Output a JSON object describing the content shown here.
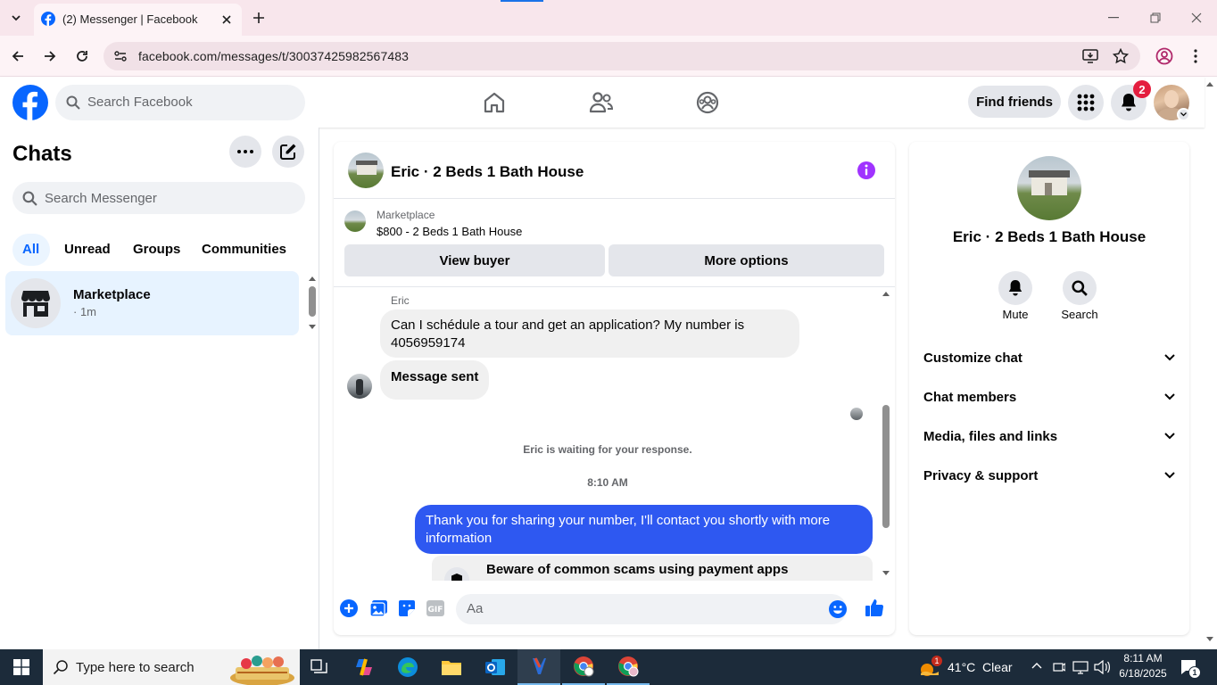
{
  "browser": {
    "tab_title": "(2) Messenger | Facebook",
    "url": "facebook.com/messages/t/30037425982567483"
  },
  "fb": {
    "search_placeholder": "Search Facebook",
    "find_friends": "Find friends",
    "notif_count": "2"
  },
  "left": {
    "title": "Chats",
    "search_placeholder": "Search Messenger",
    "filters": [
      "All",
      "Unread",
      "Groups",
      "Communities"
    ],
    "conversations": [
      {
        "name": "Marketplace",
        "meta": "· 1m"
      }
    ]
  },
  "chat": {
    "title": "Eric · 2 Beds 1 Bath House",
    "listing_label": "Marketplace",
    "listing_title": "$800 - 2 Beds 1 Bath House",
    "view_buyer": "View buyer",
    "more_options": "More options",
    "sender_name": "Eric",
    "msg1": "Can I schédule a tour and get an application? My number is 4056959174",
    "msg2": "Message sent",
    "waiting": "Eric is waiting for your response.",
    "time": "8:10 AM",
    "msg_out": "Thank you for sharing your number, I'll contact you shortly with more information",
    "scam_notice": "Beware of common scams using payment apps",
    "composer_placeholder": "Aa"
  },
  "profile": {
    "name": "Eric · 2 Beds 1 Bath House",
    "mute": "Mute",
    "search": "Search",
    "sections": [
      "Customize chat",
      "Chat members",
      "Media, files and links",
      "Privacy & support"
    ]
  },
  "taskbar": {
    "search_placeholder": "Type here to search",
    "weather": "41°C  Clear",
    "weather_badge": "1",
    "time": "8:11 AM",
    "date": "6/18/2025",
    "notif": "1"
  },
  "colors": {
    "fb_blue": "#0866ff",
    "messenger_purple": "#a033ff",
    "outgoing_bubble": "#2e58f1",
    "badge_red": "#e41e3f"
  }
}
